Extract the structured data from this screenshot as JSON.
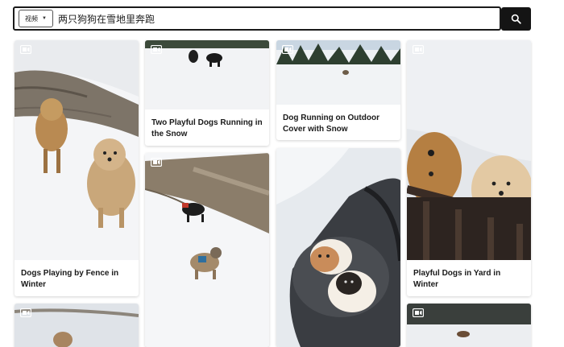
{
  "search": {
    "type_label": "视频",
    "query": "两只狗狗在雪地里奔跑",
    "button_icon": "search-icon"
  },
  "cards": [
    {
      "title": "Dogs Playing by Fence in Winter",
      "icon": "video-icon"
    },
    {
      "title": "Two Playful Dogs Running in the Snow",
      "icon": "video-icon"
    },
    {
      "title": "",
      "icon": "video-icon"
    },
    {
      "title": "Dog Running on Outdoor Cover with Snow",
      "icon": "video-icon"
    },
    {
      "title": "",
      "icon": "video-icon"
    },
    {
      "title": "Playful Dogs in Yard in Winter",
      "icon": "video-icon"
    },
    {
      "title": "",
      "icon": "video-icon"
    },
    {
      "title": "",
      "icon": "video-icon"
    }
  ],
  "colors": {
    "search_button": "#141414",
    "caption_text": "#1a1a1a"
  }
}
